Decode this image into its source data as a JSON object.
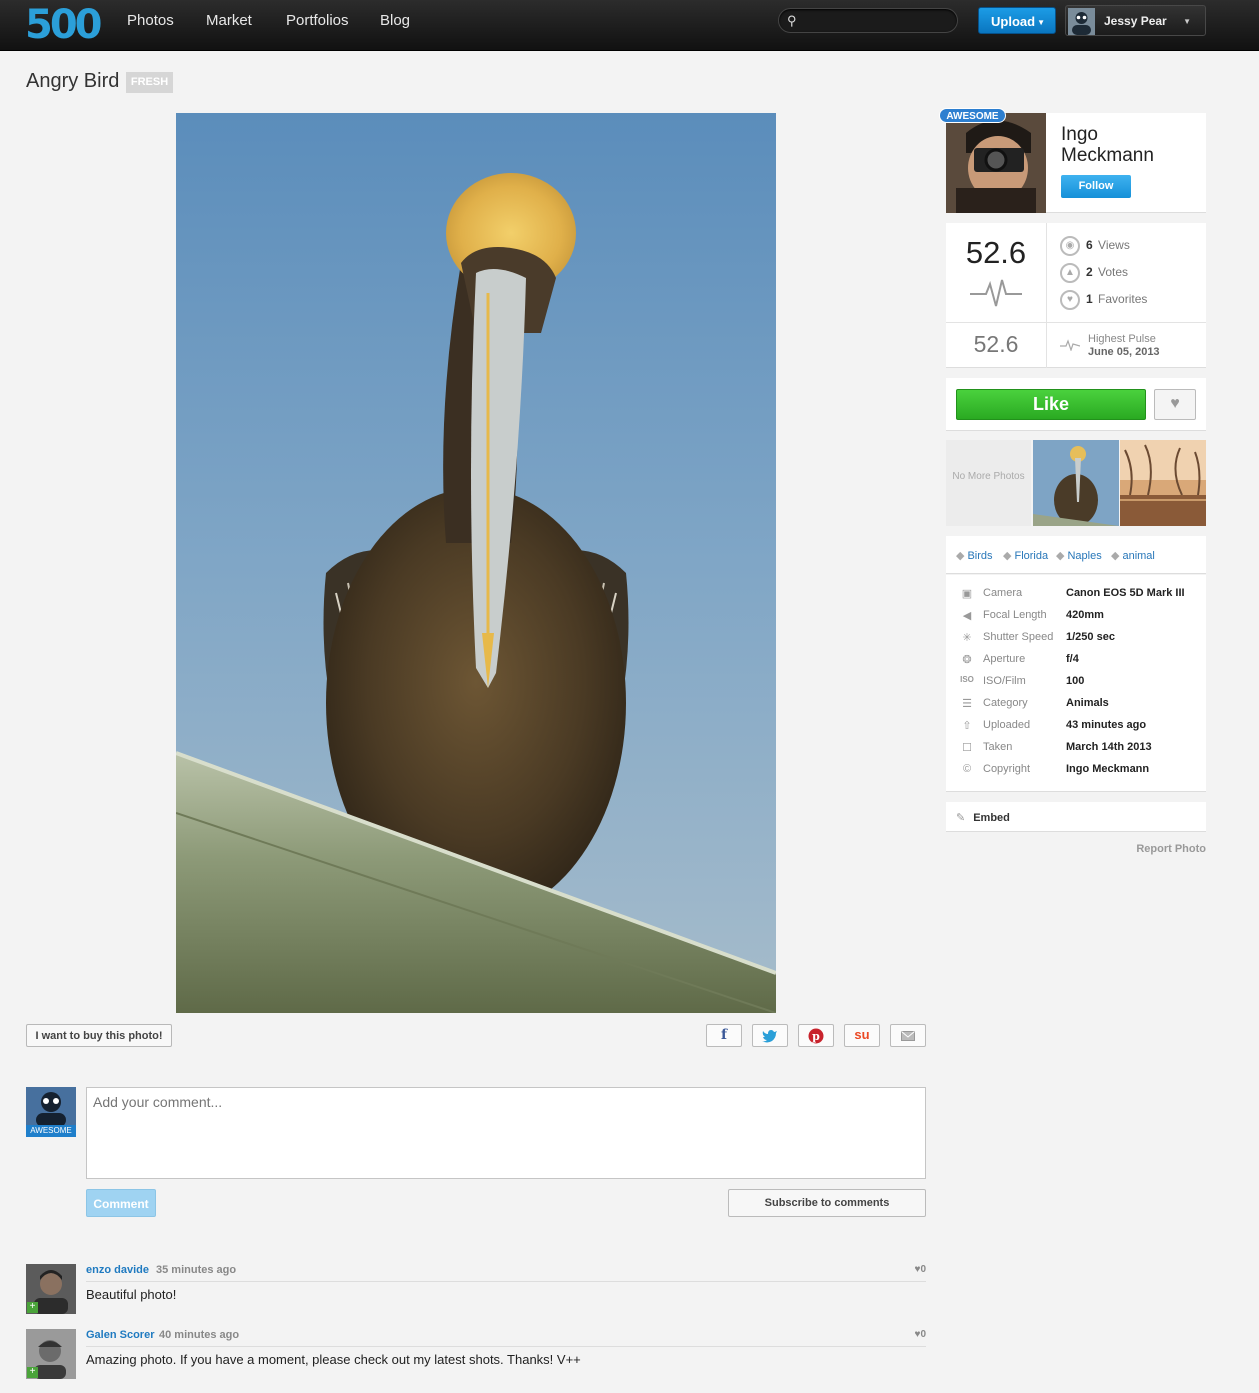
{
  "nav": {
    "logo": "500",
    "items": [
      "Photos",
      "Market",
      "Portfolios",
      "Blog"
    ],
    "search_placeholder": "",
    "upload_label": "Upload",
    "user_name": "Jessy Pear"
  },
  "photo": {
    "title": "Angry Bird",
    "badge": "FRESH"
  },
  "actions": {
    "buy_label": "I want to buy this photo!",
    "share": [
      "f",
      "t",
      "p",
      "su",
      "mail"
    ]
  },
  "composer": {
    "avatar_tag": "AWESOME",
    "placeholder": "Add your comment...",
    "submit_label": "Comment",
    "subscribe_label": "Subscribe to comments"
  },
  "comments": [
    {
      "author": "enzo davide",
      "time": "35 minutes ago",
      "likes": "♥0",
      "text": "Beautiful photo!"
    },
    {
      "author": "Galen Scorer",
      "time": "40 minutes ago",
      "likes": "♥0",
      "text": "Amazing photo. If you have a moment, please check out my latest shots. Thanks! V++"
    }
  ],
  "author": {
    "badge": "AWESOME",
    "name_line1": "Ingo",
    "name_line2": "Meckmann",
    "follow_label": "Follow"
  },
  "stats": {
    "pulse": "52.6",
    "views_count": "6",
    "views_label": "Views",
    "votes_count": "2",
    "votes_label": "Votes",
    "favorites_count": "1",
    "favorites_label": "Favorites",
    "highest_pulse_value": "52.6",
    "highest_pulse_label": "Highest Pulse",
    "highest_pulse_date": "June 05, 2013"
  },
  "like": {
    "like_label": "Like"
  },
  "thumbnails": {
    "no_more": "No More Photos"
  },
  "tags": [
    "Birds",
    "Florida",
    "Naples",
    "animal"
  ],
  "meta": [
    {
      "label": "Camera",
      "value": "Canon EOS 5D Mark III",
      "icon": "camera-icon"
    },
    {
      "label": "Focal Length",
      "value": "420mm",
      "icon": "focal-length-icon"
    },
    {
      "label": "Shutter Speed",
      "value": "1/250 sec",
      "icon": "shutter-icon"
    },
    {
      "label": "Aperture",
      "value": "f/4",
      "icon": "aperture-icon"
    },
    {
      "label": "ISO/Film",
      "value": "100",
      "icon": "iso-icon"
    },
    {
      "label": "Category",
      "value": "Animals",
      "icon": "category-icon"
    },
    {
      "label": "Uploaded",
      "value": "43 minutes ago",
      "icon": "upload-icon"
    },
    {
      "label": "Taken",
      "value": "March 14th 2013",
      "icon": "calendar-icon"
    },
    {
      "label": "Copyright",
      "value": "Ingo Meckmann",
      "icon": "copyright-icon"
    }
  ],
  "embed_label": "Embed",
  "report_label": "Report Photo"
}
